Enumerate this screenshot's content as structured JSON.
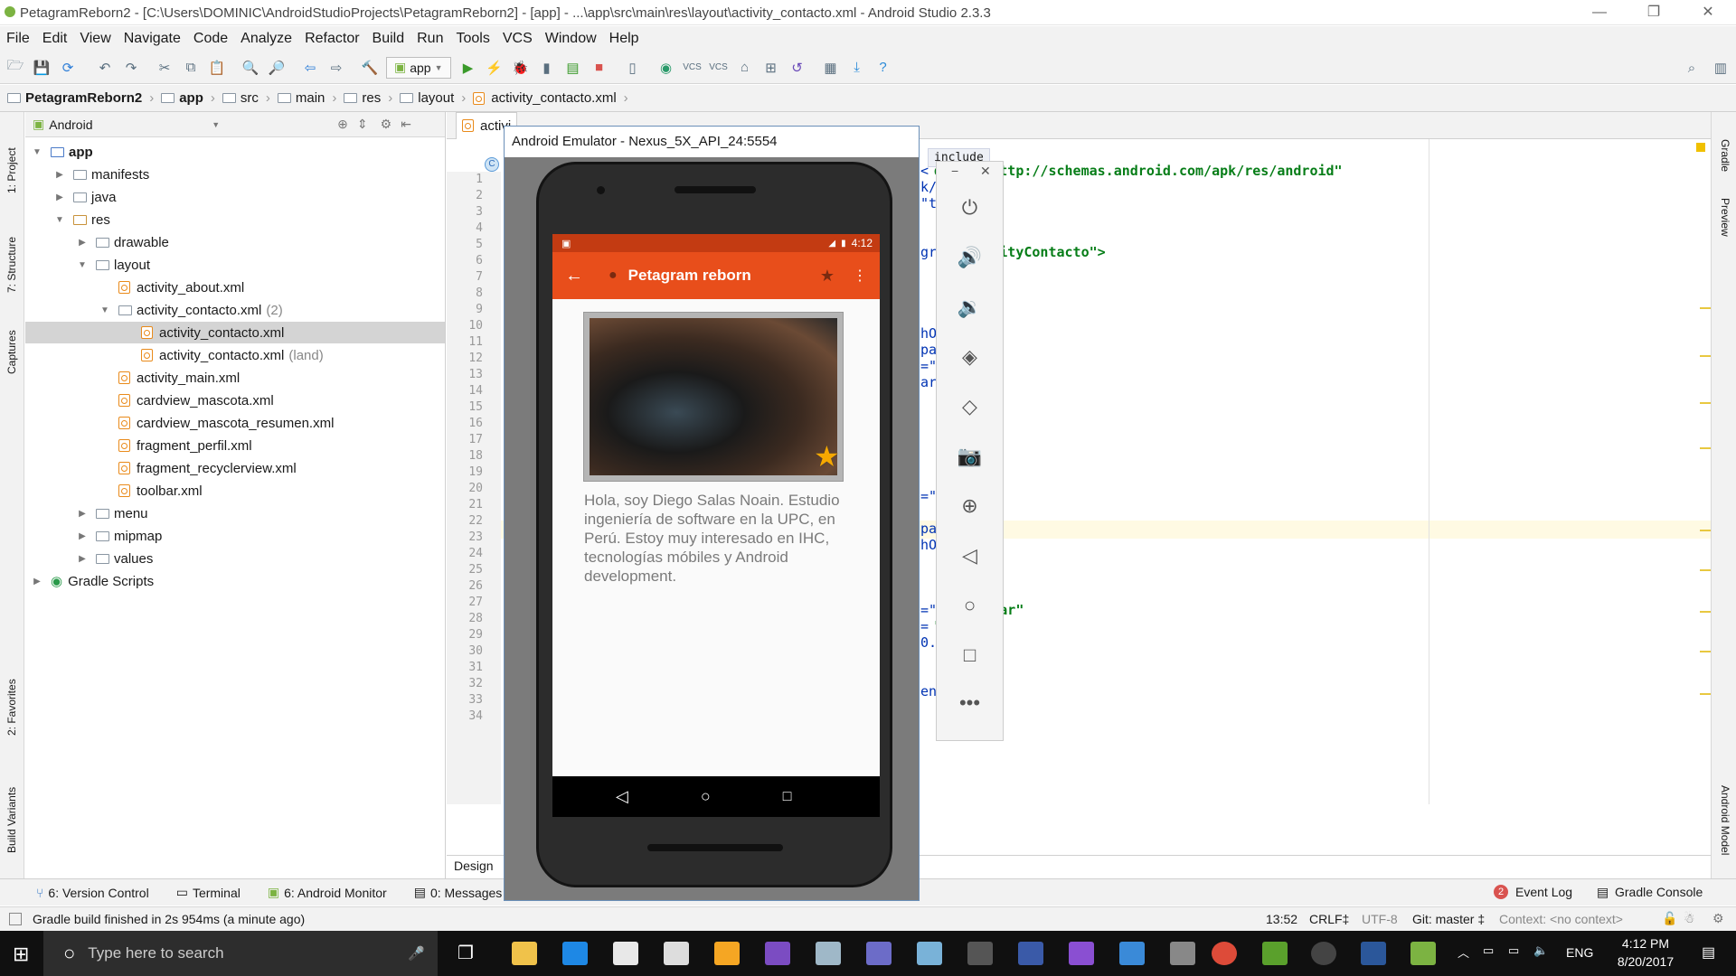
{
  "window": {
    "title": "PetagramReborn2 - [C:\\Users\\DOMINIC\\AndroidStudioProjects\\PetagramReborn2] - [app] - ...\\app\\src\\main\\res\\layout\\activity_contacto.xml - Android Studio 2.3.3",
    "controls": [
      "—",
      "❐",
      "✕"
    ]
  },
  "menu": [
    "File",
    "Edit",
    "View",
    "Navigate",
    "Code",
    "Analyze",
    "Refactor",
    "Build",
    "Run",
    "Tools",
    "VCS",
    "Window",
    "Help"
  ],
  "toolbar": {
    "run_config": "app"
  },
  "breadcrumb": [
    "PetagramReborn2",
    "app",
    "src",
    "main",
    "res",
    "layout",
    "activity_contacto.xml"
  ],
  "left_stripe": [
    "1: Project",
    "7: Structure",
    "Captures",
    "2: Favorites",
    "Build Variants"
  ],
  "right_stripe": [
    "Gradle",
    "Preview",
    "Android Model"
  ],
  "project_panel": {
    "view": "Android",
    "tree": [
      {
        "label": "app",
        "level": 0,
        "arrow": "▼",
        "type": "module",
        "bold": true
      },
      {
        "label": "manifests",
        "level": 1,
        "arrow": "▶",
        "type": "folder"
      },
      {
        "label": "java",
        "level": 1,
        "arrow": "▶",
        "type": "folder"
      },
      {
        "label": "res",
        "level": 1,
        "arrow": "▼",
        "type": "res"
      },
      {
        "label": "drawable",
        "level": 2,
        "arrow": "▶",
        "type": "folder"
      },
      {
        "label": "layout",
        "level": 2,
        "arrow": "▼",
        "type": "folder"
      },
      {
        "label": "activity_about.xml",
        "level": 3,
        "arrow": "",
        "type": "xml"
      },
      {
        "label": "activity_contacto.xml",
        "level": 3,
        "arrow": "▼",
        "type": "folder",
        "extra": "(2)"
      },
      {
        "label": "activity_contacto.xml",
        "level": 4,
        "arrow": "",
        "type": "xml",
        "selected": true
      },
      {
        "label": "activity_contacto.xml",
        "level": 4,
        "arrow": "",
        "type": "xml",
        "extra": "(land)"
      },
      {
        "label": "activity_main.xml",
        "level": 3,
        "arrow": "",
        "type": "xml"
      },
      {
        "label": "cardview_mascota.xml",
        "level": 3,
        "arrow": "",
        "type": "xml"
      },
      {
        "label": "cardview_mascota_resumen.xml",
        "level": 3,
        "arrow": "",
        "type": "xml"
      },
      {
        "label": "fragment_perfil.xml",
        "level": 3,
        "arrow": "",
        "type": "xml"
      },
      {
        "label": "fragment_recyclerview.xml",
        "level": 3,
        "arrow": "",
        "type": "xml"
      },
      {
        "label": "toolbar.xml",
        "level": 3,
        "arrow": "",
        "type": "xml"
      },
      {
        "label": "menu",
        "level": 2,
        "arrow": "▶",
        "type": "folder"
      },
      {
        "label": "mipmap",
        "level": 2,
        "arrow": "▶",
        "type": "folder"
      },
      {
        "label": "values",
        "level": 2,
        "arrow": "▶",
        "type": "folder"
      },
      {
        "label": "Gradle Scripts",
        "level": 0,
        "arrow": "▶",
        "type": "gradle"
      }
    ]
  },
  "editor": {
    "tab": "activi",
    "breadcrumb_tag": "include",
    "design_tab": "Design",
    "line_numbers": [
      "1",
      "2",
      "3",
      "4",
      "5",
      "6",
      "7",
      "8",
      "9",
      "10",
      "11",
      "12",
      "13",
      "14",
      "15",
      "16",
      "17",
      "18",
      "19",
      "20",
      "21",
      "22",
      "23",
      "24",
      "25",
      "26",
      "27",
      "28",
      "29",
      "30",
      "31",
      "32",
      "33",
      "34"
    ],
    "code_fragments": [
      {
        "line": 2,
        "text": "<",
        "str": "droid=\"http://schemas.android.com/apk/res/android\""
      },
      {
        "line": 3,
        "text": "k/",
        "str": "o\""
      },
      {
        "line": 4,
        "text": "\"to",
        "str": ""
      },
      {
        "line": 7,
        "text": "gra",
        "str": ".ActivityContacto\">"
      },
      {
        "line": 12,
        "text": "hO",
        "str": "t\""
      },
      {
        "line": 13,
        "text": "pa",
        "str": ""
      },
      {
        "line": 14,
        "text": "=\"",
        "str": ""
      },
      {
        "line": 15,
        "text": "are",
        "str": ""
      },
      {
        "line": 22,
        "text": "=\"",
        "str": ""
      },
      {
        "line": 24,
        "text": "pa",
        "str": ""
      },
      {
        "line": 25,
        "text": "hO",
        "str": "t\""
      },
      {
        "line": 29,
        "text": "=\"0",
        "str": "ctionbar\""
      },
      {
        "line": 30,
        "text": "=",
        "str": "\"0.0\""
      },
      {
        "line": 31,
        "text": "0.0\">",
        "str": ""
      },
      {
        "line": 34,
        "text": "ent\"",
        "str": ""
      }
    ]
  },
  "emulator": {
    "title": "Android Emulator - Nexus_5X_API_24:5554",
    "status_time": "4:12",
    "app_title": "Petagram reborn",
    "bio": "Hola, soy Diego Salas Noain. Estudio ingeniería de software en la UPC, en Perú. Estoy muy interesado en IHC, tecnologías móbiles y Android development."
  },
  "bottom_tools": [
    "6: Version Control",
    "Terminal",
    "6: Android Monitor",
    "0: Messages"
  ],
  "bottom_right": [
    "Event Log",
    "Gradle Console"
  ],
  "event_badge": "2",
  "status": {
    "message": "Gradle build finished in 2s 954ms (a minute ago)",
    "position": "13:52",
    "line_sep": "CRLF‡",
    "encoding": "UTF-8",
    "git": "Git: master ‡",
    "context": "Context: <no context>"
  },
  "taskbar": {
    "search_placeholder": "Type here to search",
    "lang": "ENG",
    "time": "4:12 PM",
    "date": "8/20/2017"
  },
  "colors": {
    "accent": "#e84e1b",
    "status_bar": "#c33b12",
    "ide_bg": "#f2f2f2"
  }
}
